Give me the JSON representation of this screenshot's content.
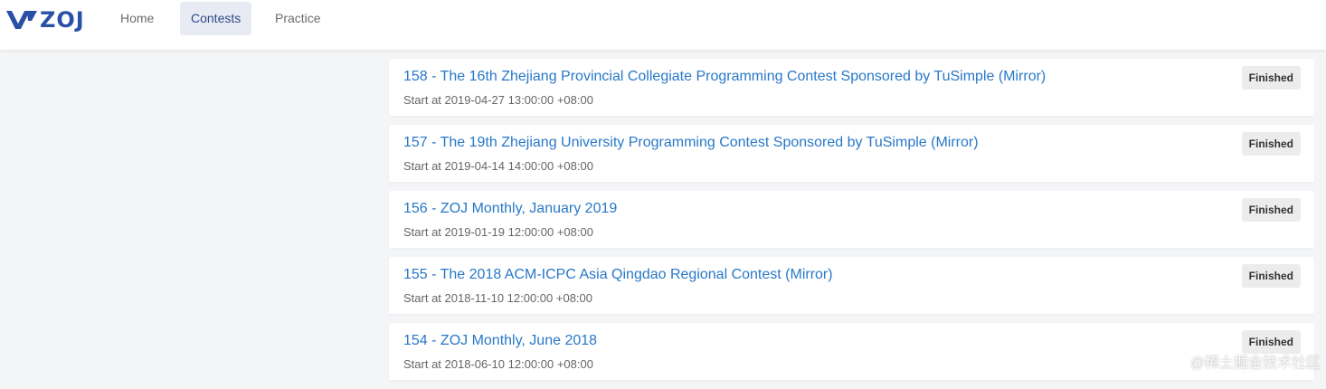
{
  "header": {
    "logo_text": "ZOJ",
    "nav": [
      {
        "label": "Home",
        "active": false
      },
      {
        "label": "Contests",
        "active": true
      },
      {
        "label": "Practice",
        "active": false
      }
    ]
  },
  "contests": [
    {
      "title": "158 - The 16th Zhejiang Provincial Collegiate Programming Contest Sponsored by TuSimple (Mirror)",
      "start": "Start at 2019-04-27 13:00:00 +08:00",
      "status": "Finished"
    },
    {
      "title": "157 - The 19th Zhejiang University Programming Contest Sponsored by TuSimple (Mirror)",
      "start": "Start at 2019-04-14 14:00:00 +08:00",
      "status": "Finished"
    },
    {
      "title": "156 - ZOJ Monthly, January 2019",
      "start": "Start at 2019-01-19 12:00:00 +08:00",
      "status": "Finished"
    },
    {
      "title": "155 - The 2018 ACM-ICPC Asia Qingdao Regional Contest (Mirror)",
      "start": "Start at 2018-11-10 12:00:00 +08:00",
      "status": "Finished"
    },
    {
      "title": "154 - ZOJ Monthly, June 2018",
      "start": "Start at 2018-06-10 12:00:00 +08:00",
      "status": "Finished"
    }
  ],
  "watermark": "@稀土掘金技术社区",
  "colors": {
    "link": "#2878c8",
    "brand": "#2a4fa7",
    "nav_active_bg": "#e8ebf3"
  }
}
